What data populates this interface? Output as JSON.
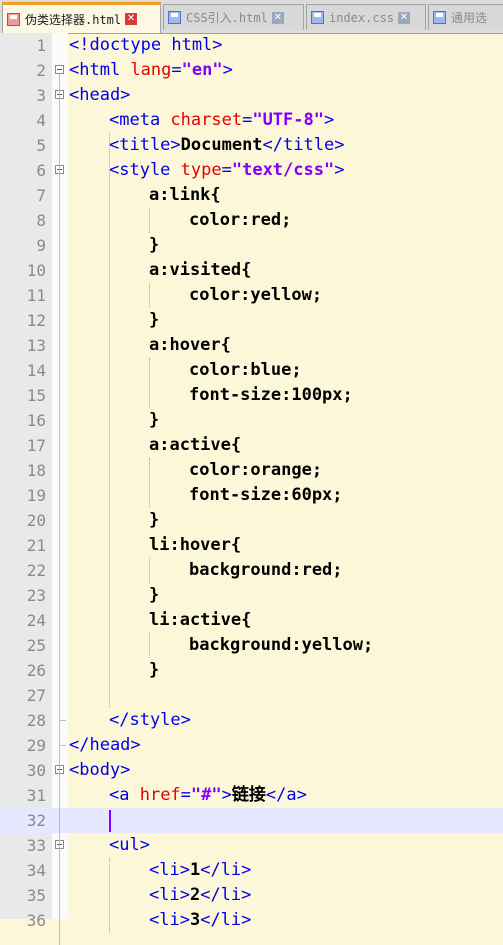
{
  "tabs": [
    {
      "label": "伪类选择器.html",
      "active": true
    },
    {
      "label": "CSS引入.html",
      "active": false
    },
    {
      "label": "index.css",
      "active": false
    },
    {
      "label": "通用选",
      "active": false
    }
  ],
  "current_line": 32,
  "lines": [
    {
      "n": "1",
      "indent": 0,
      "parts": [
        [
          "tag",
          "<!doctype html>"
        ]
      ]
    },
    {
      "n": "2",
      "indent": 0,
      "fold": "open",
      "parts": [
        [
          "tag",
          "<html "
        ],
        [
          "attr",
          "lang"
        ],
        [
          "tag",
          "="
        ],
        [
          "val",
          "\"en\""
        ],
        [
          "tag",
          ">"
        ]
      ]
    },
    {
      "n": "3",
      "indent": 0,
      "fold": "open",
      "parts": [
        [
          "tag",
          "<head>"
        ]
      ]
    },
    {
      "n": "4",
      "indent": 1,
      "parts": [
        [
          "tag",
          "<meta "
        ],
        [
          "attr",
          "charset"
        ],
        [
          "tag",
          "="
        ],
        [
          "val",
          "\"UTF-8\""
        ],
        [
          "tag",
          ">"
        ]
      ]
    },
    {
      "n": "5",
      "indent": 1,
      "parts": [
        [
          "tag",
          "<title>"
        ],
        [
          "text",
          "Document"
        ],
        [
          "tag",
          "</title>"
        ]
      ]
    },
    {
      "n": "6",
      "indent": 1,
      "fold": "open",
      "parts": [
        [
          "tag",
          "<style "
        ],
        [
          "attr",
          "type"
        ],
        [
          "tag",
          "="
        ],
        [
          "val",
          "\"text/css\""
        ],
        [
          "tag",
          ">"
        ]
      ]
    },
    {
      "n": "7",
      "indent": 2,
      "parts": [
        [
          "text",
          "a:link{"
        ]
      ]
    },
    {
      "n": "8",
      "indent": 3,
      "parts": [
        [
          "text",
          "color:red;"
        ]
      ]
    },
    {
      "n": "9",
      "indent": 2,
      "parts": [
        [
          "text",
          "}"
        ]
      ]
    },
    {
      "n": "10",
      "indent": 2,
      "parts": [
        [
          "text",
          "a:visited{"
        ]
      ]
    },
    {
      "n": "11",
      "indent": 3,
      "parts": [
        [
          "text",
          "color:yellow;"
        ]
      ]
    },
    {
      "n": "12",
      "indent": 2,
      "parts": [
        [
          "text",
          "}"
        ]
      ]
    },
    {
      "n": "13",
      "indent": 2,
      "parts": [
        [
          "text",
          "a:hover{"
        ]
      ]
    },
    {
      "n": "14",
      "indent": 3,
      "parts": [
        [
          "text",
          "color:blue;"
        ]
      ]
    },
    {
      "n": "15",
      "indent": 3,
      "parts": [
        [
          "text",
          "font-size:100px;"
        ]
      ]
    },
    {
      "n": "16",
      "indent": 2,
      "parts": [
        [
          "text",
          "}"
        ]
      ]
    },
    {
      "n": "17",
      "indent": 2,
      "parts": [
        [
          "text",
          "a:active{"
        ]
      ]
    },
    {
      "n": "18",
      "indent": 3,
      "parts": [
        [
          "text",
          "color:orange;"
        ]
      ]
    },
    {
      "n": "19",
      "indent": 3,
      "parts": [
        [
          "text",
          "font-size:60px;"
        ]
      ]
    },
    {
      "n": "20",
      "indent": 2,
      "parts": [
        [
          "text",
          "}"
        ]
      ]
    },
    {
      "n": "21",
      "indent": 2,
      "parts": [
        [
          "text",
          "li:hover{"
        ]
      ]
    },
    {
      "n": "22",
      "indent": 3,
      "parts": [
        [
          "text",
          "background:red;"
        ]
      ]
    },
    {
      "n": "23",
      "indent": 2,
      "parts": [
        [
          "text",
          "}"
        ]
      ]
    },
    {
      "n": "24",
      "indent": 2,
      "parts": [
        [
          "text",
          "li:active{"
        ]
      ]
    },
    {
      "n": "25",
      "indent": 3,
      "parts": [
        [
          "text",
          "background:yellow;"
        ]
      ]
    },
    {
      "n": "26",
      "indent": 2,
      "parts": [
        [
          "text",
          "}"
        ]
      ]
    },
    {
      "n": "27",
      "indent": 0,
      "parts": []
    },
    {
      "n": "28",
      "indent": 1,
      "fold": "end",
      "parts": [
        [
          "tag",
          "</style>"
        ]
      ]
    },
    {
      "n": "29",
      "indent": 0,
      "fold": "end",
      "parts": [
        [
          "tag",
          "</head>"
        ]
      ]
    },
    {
      "n": "30",
      "indent": 0,
      "fold": "open",
      "parts": [
        [
          "tag",
          "<body>"
        ]
      ]
    },
    {
      "n": "31",
      "indent": 1,
      "parts": [
        [
          "tag",
          "<a "
        ],
        [
          "attr",
          "href"
        ],
        [
          "tag",
          "="
        ],
        [
          "val",
          "\"#\""
        ],
        [
          "tag",
          ">"
        ],
        [
          "text",
          "链接"
        ],
        [
          "tag",
          "</a>"
        ]
      ]
    },
    {
      "n": "32",
      "indent": 1,
      "parts": []
    },
    {
      "n": "33",
      "indent": 1,
      "fold": "open",
      "parts": [
        [
          "tag",
          "<ul>"
        ]
      ]
    },
    {
      "n": "34",
      "indent": 2,
      "parts": [
        [
          "tag",
          "<li>"
        ],
        [
          "text",
          "1"
        ],
        [
          "tag",
          "</li>"
        ]
      ]
    },
    {
      "n": "35",
      "indent": 2,
      "parts": [
        [
          "tag",
          "<li>"
        ],
        [
          "text",
          "2"
        ],
        [
          "tag",
          "</li>"
        ]
      ]
    },
    {
      "n": "36",
      "indent": 2,
      "parts": [
        [
          "tag",
          "<li>"
        ],
        [
          "text",
          "3"
        ],
        [
          "tag",
          "</li>"
        ]
      ]
    }
  ],
  "colors": {
    "tag": "#0000e6",
    "attr": "#e60000",
    "val": "#8000ff",
    "text": "#000000",
    "editor_bg": "#fcf7d8",
    "current_line_bg": "#e6e8ff"
  }
}
